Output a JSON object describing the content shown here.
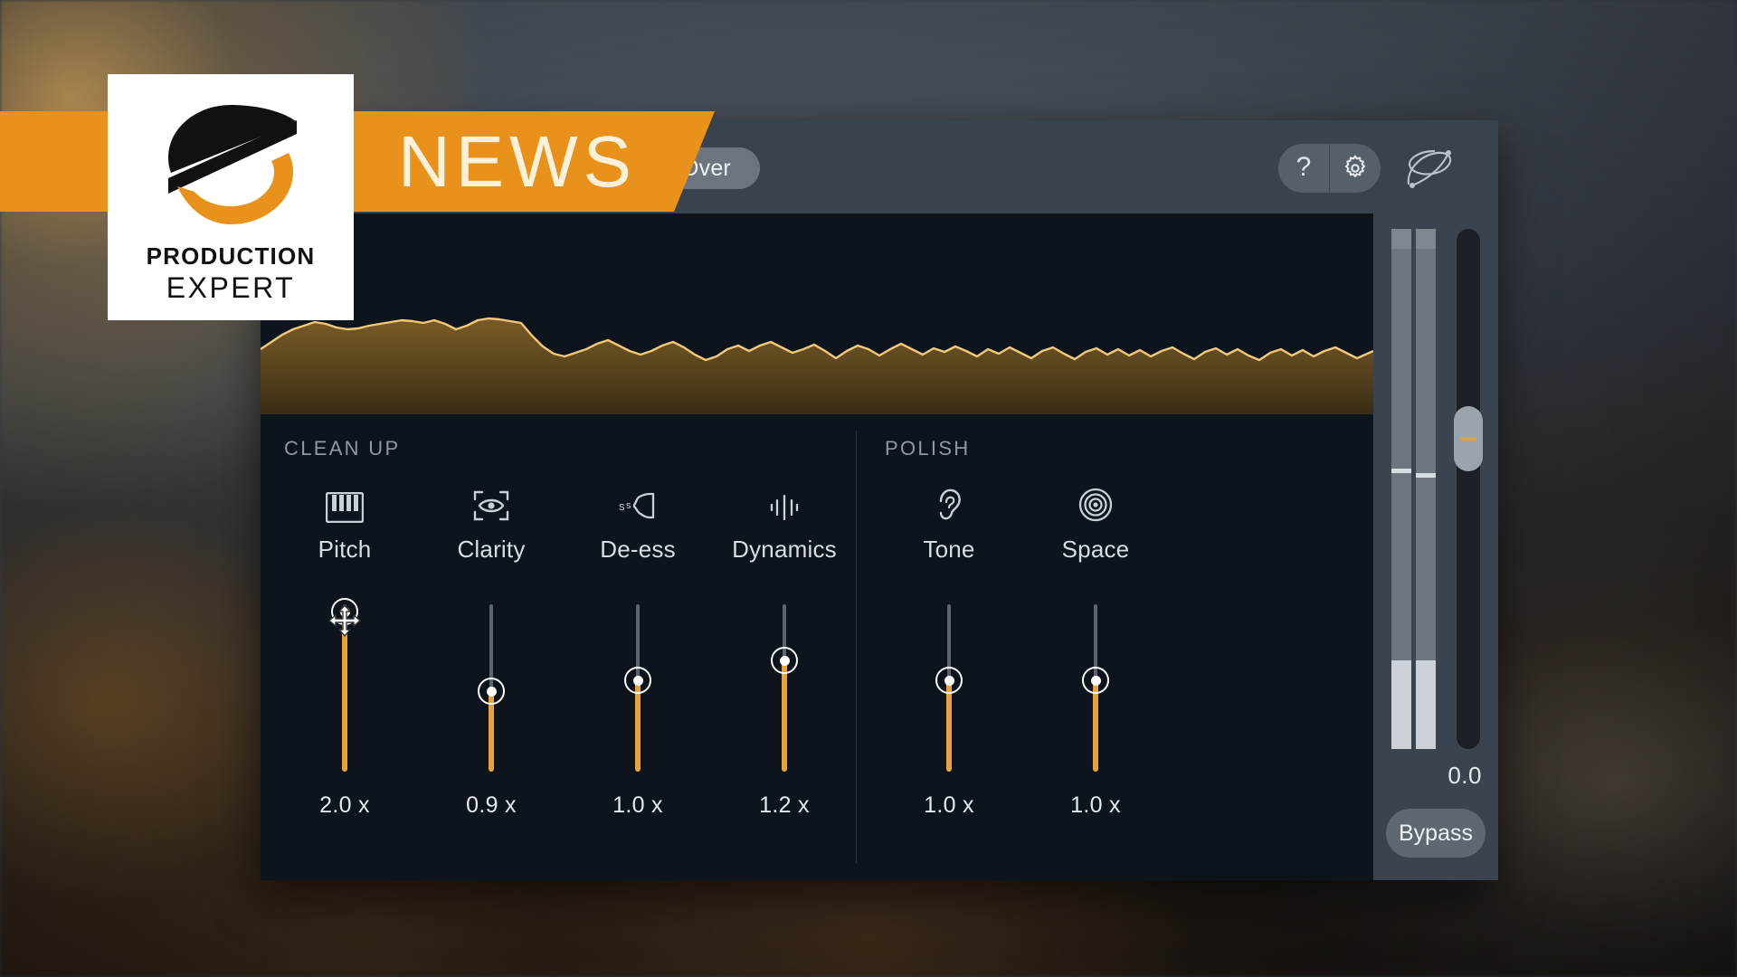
{
  "background": {
    "description": "blurred-studio-photo",
    "base_color": "#3a4149",
    "warm_accent": "#d6a860"
  },
  "banner": {
    "label": "NEWS",
    "color": "#e8921b",
    "text_color": "#fdf1dc"
  },
  "logo": {
    "word1": "PRODUCTION",
    "word2": "EXPERT",
    "mark_dark": "#111111",
    "mark_orange": "#e8921b"
  },
  "plugin": {
    "header": {
      "start_over_label": "Start Over",
      "help_icon": "question-mark-icon",
      "settings_icon": "gear-icon",
      "brand_icon": "izotope-squiggle-logo"
    },
    "spectrum": {
      "line_color": "#f0c265",
      "fill_color": "#6b5226",
      "background": "#0d141c"
    },
    "sections": [
      {
        "label": "CLEAN UP",
        "modules": [
          {
            "name": "Pitch",
            "icon": "piano-keys-icon",
            "value": "2.0 x",
            "knob_pct": 100,
            "active": true
          },
          {
            "name": "Clarity",
            "icon": "eye-scan-icon",
            "value": "0.9 x",
            "knob_pct": 52,
            "active": false
          },
          {
            "name": "De-ess",
            "icon": "sibilance-face-icon",
            "value": "1.0 x",
            "knob_pct": 58,
            "active": false
          },
          {
            "name": "Dynamics",
            "icon": "waveform-bars-icon",
            "value": "1.2 x",
            "knob_pct": 68,
            "active": false
          }
        ]
      },
      {
        "label": "POLISH",
        "modules": [
          {
            "name": "Tone",
            "icon": "ear-icon",
            "value": "1.0 x",
            "knob_pct": 58,
            "active": false
          },
          {
            "name": "Space",
            "icon": "concentric-circles-icon",
            "value": "1.0 x",
            "knob_pct": 58,
            "active": false
          }
        ]
      }
    ],
    "output": {
      "fader_value": "0.0",
      "fader_pct": 64,
      "bypass_label": "Bypass",
      "meters": [
        {
          "channel": "L",
          "level_pct": 17,
          "peak_pct": 54
        },
        {
          "channel": "R",
          "level_pct": 17,
          "peak_pct": 53
        }
      ]
    },
    "accent_color": "#e9a33c",
    "panel_color": "#0d141c",
    "header_color": "#39434d"
  }
}
